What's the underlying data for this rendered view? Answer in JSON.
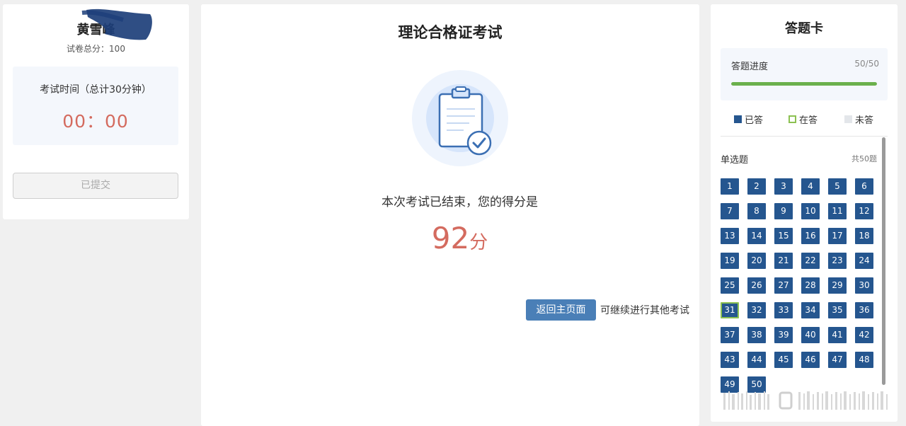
{
  "user": {
    "name": "黄雪峰",
    "total_score": "试卷总分：100"
  },
  "timer": {
    "label": "考试时间（总计30分钟）",
    "value": "00：00"
  },
  "submit_button": "已提交",
  "exam": {
    "title": "理论合格证考试",
    "result_message": "本次考试已结束，您的得分是",
    "score": "92",
    "score_unit": "分",
    "home_button": "返回主页面",
    "continue_text": "可继续进行其他考试"
  },
  "answer_card": {
    "title": "答题卡",
    "progress_label": "答题进度",
    "progress_count": "50/50",
    "progress_fraction": 1.0,
    "legend": {
      "answered": "已答",
      "current": "在答",
      "unanswered": "未答"
    },
    "section_name": "单选题",
    "section_count": "共50题",
    "current_question": 31,
    "questions": [
      "1",
      "2",
      "3",
      "4",
      "5",
      "6",
      "7",
      "8",
      "9",
      "10",
      "11",
      "12",
      "13",
      "14",
      "15",
      "16",
      "17",
      "18",
      "19",
      "20",
      "21",
      "22",
      "23",
      "24",
      "25",
      "26",
      "27",
      "28",
      "29",
      "30",
      "31",
      "32",
      "33",
      "34",
      "35",
      "36",
      "37",
      "38",
      "39",
      "40",
      "41",
      "42",
      "43",
      "44",
      "45",
      "46",
      "47",
      "48",
      "49",
      "50"
    ]
  },
  "colors": {
    "accent_blue": "#25568f",
    "button_blue": "#4a7fb7",
    "score_red": "#d46b5f",
    "progress_green": "#6ab04c",
    "current_border": "#8cc152"
  }
}
